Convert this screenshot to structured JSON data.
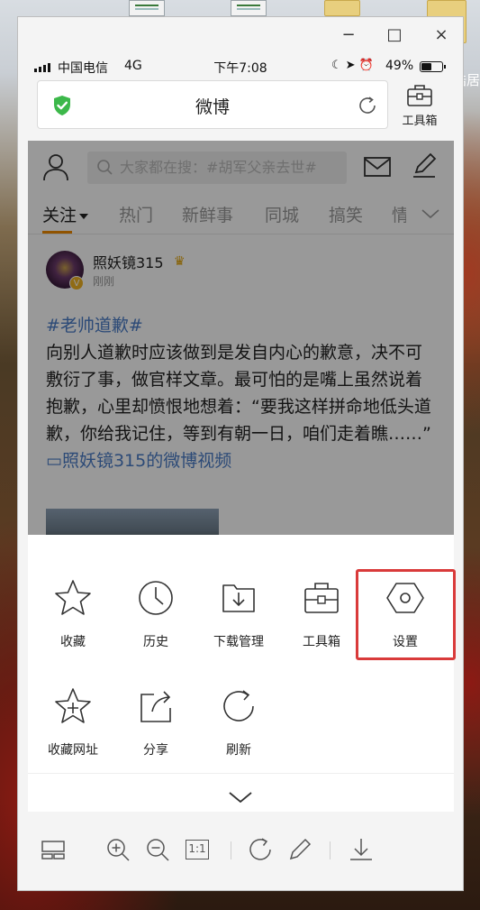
{
  "desktop": {
    "side_text": "浩居"
  },
  "window": {
    "minimize": "−",
    "maximize": "□",
    "close": "×"
  },
  "statusbar": {
    "carrier": "中国电信",
    "network": "4G",
    "time": "下午7:08",
    "battery": "49%"
  },
  "urlbar": {
    "title": "微博"
  },
  "toolbox_top": {
    "label": "工具箱"
  },
  "weibo": {
    "search_placeholder": "大家都在搜：#胡军父亲去世#",
    "tabs": [
      "关注",
      "热门",
      "新鲜事",
      "同城",
      "搞笑",
      "情"
    ],
    "post": {
      "username": "照妖镜315",
      "time": "刚刚",
      "hashtag": "#老帅道歉#",
      "body": "向别人道歉时应该做到是发自内心的歉意，决不可敷衍了事，做官样文章。最可怕的是嘴上虽然说着抱歉，心里却愤恨地想着：“要我这样拼命地低头道歉，你给我记住，等到有朝一日，咱们走着瞧……”",
      "video_link": "照妖镜315的微博视频"
    }
  },
  "menu": {
    "row1": [
      "收藏",
      "历史",
      "下载管理",
      "工具箱",
      "设置"
    ],
    "row2": [
      "收藏网址",
      "分享",
      "刷新"
    ]
  },
  "bottombar": {
    "actual_size": "1:1"
  },
  "colors": {
    "accent": "#f08a00",
    "link": "#4a7cc7",
    "highlight": "#d93a3a",
    "shield": "#3cb84a"
  }
}
